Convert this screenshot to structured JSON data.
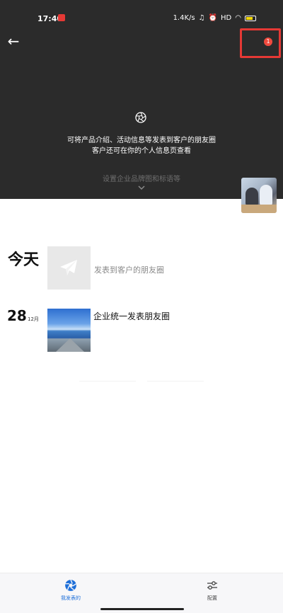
{
  "status_bar": {
    "time": "17:40",
    "net_speed": "1.4K/s",
    "signal": "HD",
    "battery": "100"
  },
  "header": {
    "notification_count": "1"
  },
  "hero": {
    "line1": "可将产品介绍、活动信息等发表到客户的朋友圈",
    "line2": "客户还可在你的个人信息页查看",
    "hint": "设置企业品牌图和标语等"
  },
  "feed": {
    "today_label": "今天",
    "compose_text": "发表到客户的朋友圈",
    "post": {
      "day": "28",
      "month": "12月",
      "title": "企业统一发表朋友圈"
    }
  },
  "bottom_nav": {
    "tabs": [
      {
        "label": "我发表的",
        "icon": "shutter-icon",
        "active": true
      },
      {
        "label": "配置",
        "icon": "sliders-icon",
        "active": false
      }
    ]
  },
  "colors": {
    "hero_bg": "#2b2b2b",
    "accent": "#1e6fd9",
    "badge": "#f04a3e",
    "highlight_frame": "#e53935"
  }
}
